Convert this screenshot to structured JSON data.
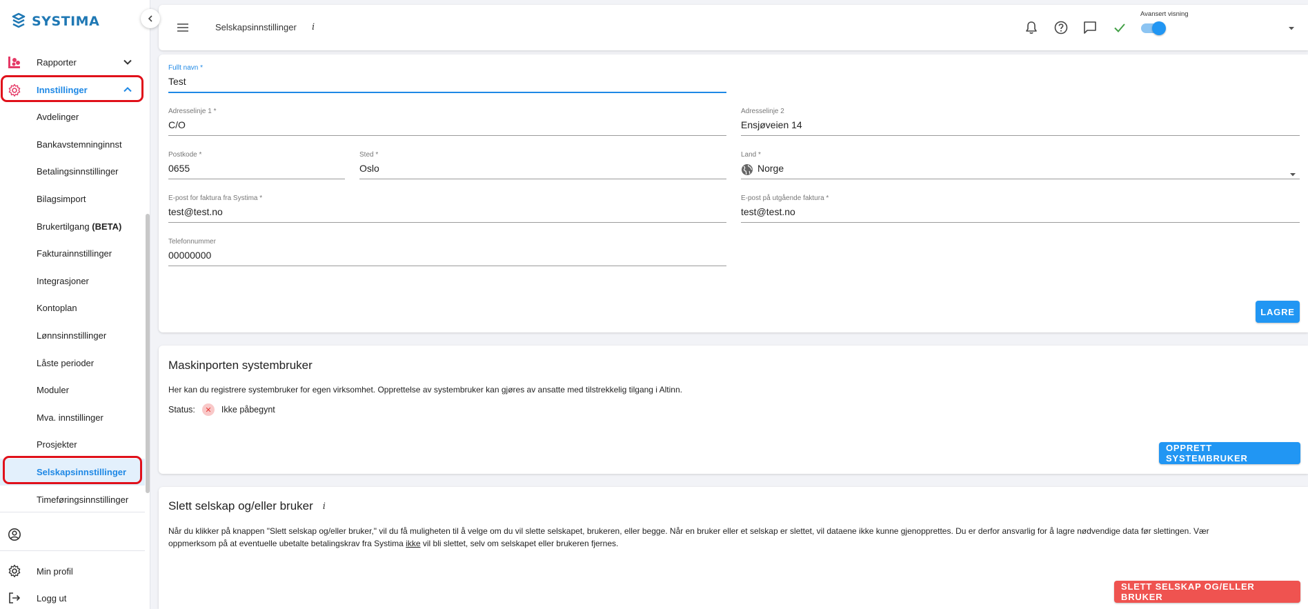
{
  "app": {
    "logo_text": "SYSTIMA",
    "accent": "#1e88e5",
    "danger": "#ef5350"
  },
  "sidebar": {
    "top_items": [
      {
        "label": "Rapporter",
        "icon": "chart-icon"
      },
      {
        "label": "Innstillinger",
        "icon": "gear-icon"
      }
    ],
    "sub_items": [
      "Avdelinger",
      "Bankavstemninginnst",
      "Betalingsinnstillinger",
      "Bilagsimport",
      "Brukertilgang",
      "Fakturainnstillinger",
      "Integrasjoner",
      "Kontoplan",
      "Lønnsinnstillinger",
      "Låste perioder",
      "Moduler",
      "Mva. innstillinger",
      "Prosjekter",
      "Selskapsinnstillinger",
      "Timeføringsinnstillinger"
    ],
    "brukertilgang_badge": "(BETA)",
    "selected": "Selskapsinnstillinger",
    "bottom": {
      "profile": "Min profil",
      "logout": "Logg ut"
    }
  },
  "header": {
    "title": "Selskapsinnstillinger",
    "info": "i",
    "advanced_label": "Avansert visning",
    "advanced_on": true
  },
  "company_form": {
    "full_name": {
      "label": "Fullt navn *",
      "value": "Test"
    },
    "address1": {
      "label": "Adresselinje 1 *",
      "value": "C/O"
    },
    "address2": {
      "label": "Adresselinje 2",
      "value": "Ensjøveien 14"
    },
    "postcode": {
      "label": "Postkode *",
      "value": "0655"
    },
    "city": {
      "label": "Sted *",
      "value": "Oslo"
    },
    "country": {
      "label": "Land *",
      "value": "Norge"
    },
    "invoice_email_from": {
      "label": "E-post for faktura fra Systima *",
      "value": "test@test.no"
    },
    "invoice_email_out": {
      "label": "E-post på utgående faktura *",
      "value": "test@test.no"
    },
    "phone": {
      "label": "Telefonnummer",
      "value": "00000000"
    },
    "save_label": "LAGRE"
  },
  "maskinporten": {
    "title": "Maskinporten systembruker",
    "description": "Her kan du registrere systembruker for egen virksomhet. Opprettelse av systembruker kan gjøres av ansatte med tilstrekkelig tilgang i Altinn.",
    "status_label": "Status:",
    "status_value": "Ikke påbegynt",
    "button_label": "OPPRETT SYSTEMBRUKER"
  },
  "delete": {
    "title": "Slett selskap og/eller bruker",
    "info": "i",
    "text_1": "Når du klikker på knappen \"Slett selskap og/eller bruker,\" vil du få muligheten til å velge om du vil slette selskapet, brukeren, eller begge. Når en bruker eller et selskap er slettet, vil dataene ikke kunne gjenopprettes. Du er derfor ansvarlig for å lagre nødvendige data før slettingen. Vær",
    "text_2a": "oppmerksom på at eventuelle ubetalte betalingskrav fra Systima",
    "text_2b": "ikke",
    "text_2c": "vil bli slettet, selv om selskapet eller brukeren fjernes.",
    "button_label": "SLETT SELSKAP OG/ELLER BRUKER"
  }
}
